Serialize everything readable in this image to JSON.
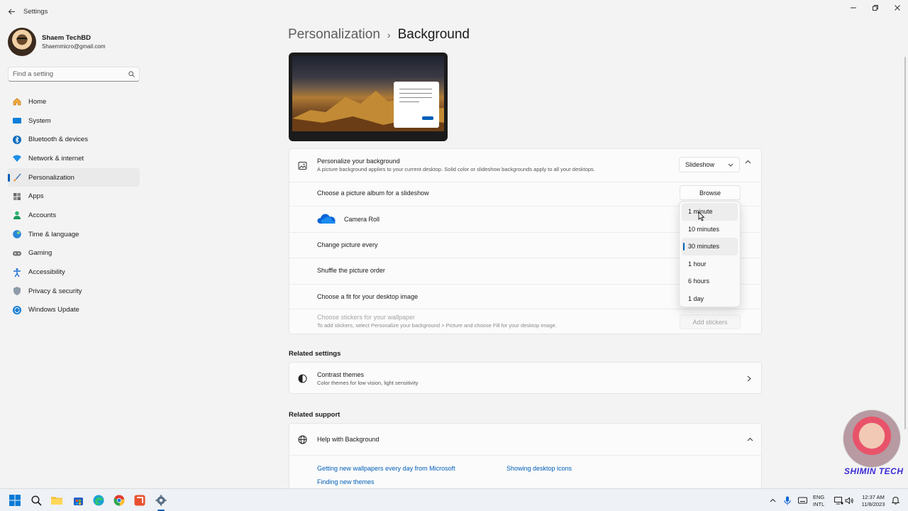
{
  "app": {
    "title": "Settings"
  },
  "profile": {
    "name": "Shaem TechBD",
    "email": "Shaemmicro@gmail.com"
  },
  "search": {
    "placeholder": "Find a setting"
  },
  "nav": [
    {
      "label": "Home",
      "icon": "home-icon",
      "active": false
    },
    {
      "label": "System",
      "icon": "system-icon",
      "active": false
    },
    {
      "label": "Bluetooth & devices",
      "icon": "bluetooth-icon",
      "active": false
    },
    {
      "label": "Network & internet",
      "icon": "wifi-icon",
      "active": false
    },
    {
      "label": "Personalization",
      "icon": "brush-icon",
      "active": true
    },
    {
      "label": "Apps",
      "icon": "apps-icon",
      "active": false
    },
    {
      "label": "Accounts",
      "icon": "accounts-icon",
      "active": false
    },
    {
      "label": "Time & language",
      "icon": "globe-icon",
      "active": false
    },
    {
      "label": "Gaming",
      "icon": "gamepad-icon",
      "active": false
    },
    {
      "label": "Accessibility",
      "icon": "accessibility-icon",
      "active": false
    },
    {
      "label": "Privacy & security",
      "icon": "shield-icon",
      "active": false
    },
    {
      "label": "Windows Update",
      "icon": "update-icon",
      "active": false
    }
  ],
  "breadcrumb": {
    "parent": "Personalization",
    "separator": "›",
    "current": "Background"
  },
  "background": {
    "title": "Personalize your background",
    "subtitle": "A picture background applies to your current desktop. Solid color or slideshow backgrounds apply to all your desktops.",
    "mode_value": "Slideshow",
    "album_label": "Choose a picture album for a slideshow",
    "browse_label": "Browse",
    "album_name": "Camera Roll",
    "change_label": "Change picture every",
    "shuffle_label": "Shuffle the picture order",
    "fit_label": "Choose a fit for your desktop image",
    "stickers_label": "Choose stickers for your wallpaper",
    "stickers_sub": "To add stickers, select Personalize your background > Picture and choose Fill for your desktop image.",
    "stickers_button": "Add stickers"
  },
  "interval_menu": {
    "options": [
      "1 minute",
      "10 minutes",
      "30 minutes",
      "1 hour",
      "6 hours",
      "1 day"
    ],
    "selected": "30 minutes",
    "hovered": "1 minute"
  },
  "related_settings": {
    "heading": "Related settings",
    "title": "Contrast themes",
    "subtitle": "Color themes for low vision, light sensitivity"
  },
  "related_support": {
    "heading": "Related support",
    "title": "Help with Background",
    "links": [
      "Getting new wallpapers every day from Microsoft",
      "Showing desktop icons",
      "Finding new themes"
    ]
  },
  "taskbar": {
    "lang_top": "ENG",
    "lang_bottom": "INTL",
    "time": "12:37 AM",
    "date": "11/8/2023"
  },
  "watermark": {
    "text": "SHIMIN TECH"
  },
  "colors": {
    "accent": "#005fb8",
    "link": "#005fb8",
    "watermark": "#3a2bd6"
  }
}
